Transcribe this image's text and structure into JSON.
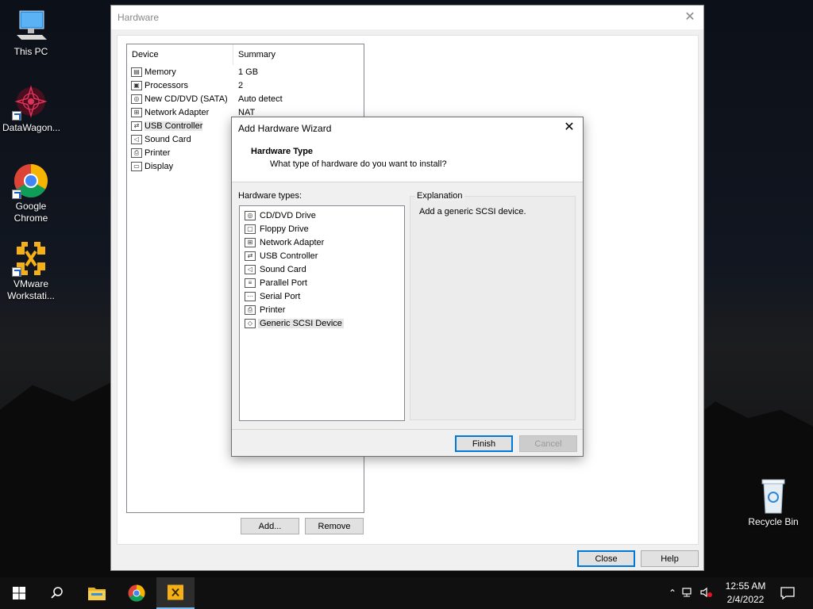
{
  "desktop": {
    "icons": [
      {
        "label": "This PC",
        "icon": "this-pc-icon"
      },
      {
        "label": "DataWagon...",
        "icon": "datawagon-icon"
      },
      {
        "label": "Google Chrome",
        "icon": "chrome-icon"
      },
      {
        "label": "VMware Workstati...",
        "icon": "vmware-icon"
      },
      {
        "label": "Recycle Bin",
        "icon": "recycle-bin-icon"
      }
    ]
  },
  "hardware_window": {
    "title": "Hardware",
    "columns": {
      "device": "Device",
      "summary": "Summary"
    },
    "devices": [
      {
        "name": "Memory",
        "summary": "1 GB",
        "icon": "memory-icon"
      },
      {
        "name": "Processors",
        "summary": "2",
        "icon": "processor-icon"
      },
      {
        "name": "New CD/DVD (SATA)",
        "summary": "Auto detect",
        "icon": "cd-icon"
      },
      {
        "name": "Network Adapter",
        "summary": "NAT",
        "icon": "network-icon"
      },
      {
        "name": "USB Controller",
        "summary": "",
        "icon": "usb-icon",
        "selected": true
      },
      {
        "name": "Sound Card",
        "summary": "",
        "icon": "sound-icon"
      },
      {
        "name": "Printer",
        "summary": "",
        "icon": "printer-icon"
      },
      {
        "name": "Display",
        "summary": "",
        "icon": "display-icon"
      }
    ],
    "add_label": "Add...",
    "remove_label": "Remove",
    "close_label": "Close",
    "help_label": "Help"
  },
  "wizard": {
    "title": "Add Hardware Wizard",
    "header_title": "Hardware Type",
    "header_subtitle": "What type of hardware do you want to install?",
    "types_label": "Hardware types:",
    "types": [
      {
        "name": "CD/DVD Drive",
        "icon": "cd-icon"
      },
      {
        "name": "Floppy Drive",
        "icon": "floppy-icon"
      },
      {
        "name": "Network Adapter",
        "icon": "network-icon"
      },
      {
        "name": "USB Controller",
        "icon": "usb-icon"
      },
      {
        "name": "Sound Card",
        "icon": "sound-icon"
      },
      {
        "name": "Parallel Port",
        "icon": "parallel-port-icon"
      },
      {
        "name": "Serial Port",
        "icon": "serial-port-icon"
      },
      {
        "name": "Printer",
        "icon": "printer-icon"
      },
      {
        "name": "Generic SCSI Device",
        "icon": "scsi-icon",
        "selected": true
      }
    ],
    "explanation_label": "Explanation",
    "explanation_text": "Add a generic SCSI device.",
    "finish_label": "Finish",
    "cancel_label": "Cancel"
  },
  "taskbar": {
    "time": "12:55 AM",
    "date": "2/4/2022"
  }
}
